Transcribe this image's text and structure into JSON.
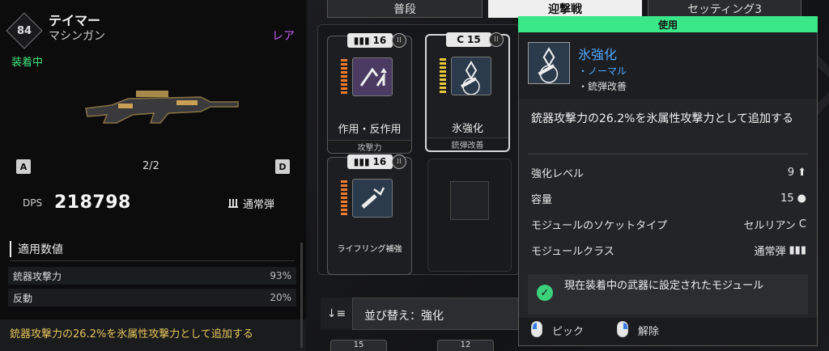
{
  "weapon": {
    "level": "84",
    "name": "テイマー",
    "type": "マシンガン",
    "rarity": "レア",
    "status": "装着中",
    "key_left": "A",
    "key_right": "D",
    "page": "2/2",
    "dps_label": "DPS",
    "dps_value": "218798",
    "ammo_type": "通常弾"
  },
  "applied": {
    "title": "適用数値",
    "stats": [
      {
        "name": "銃器攻撃力",
        "value": "93%"
      },
      {
        "name": "反動",
        "value": "20%"
      }
    ],
    "description": "銃器攻撃力の26.2%を氷属性攻撃力として追加する"
  },
  "tabs": [
    "普段",
    "迎撃戦",
    "セッティング3"
  ],
  "modules": [
    {
      "cost": "16",
      "name": "作用・反作用",
      "tag": "攻撃力",
      "bar_color": "#f07c2a"
    },
    {
      "cost": "15",
      "name": "氷強化",
      "tag": "銃弾改善",
      "bar_color": "#e8c93a"
    },
    {
      "cost": "16",
      "name": "ライフリング補強",
      "tag": "",
      "bar_color": "#f07c2a"
    }
  ],
  "sort": {
    "label": "並び替え：強化"
  },
  "bottom_cards": [
    "15",
    "12"
  ],
  "tooltip": {
    "header": "使用",
    "name": "氷強化",
    "rarity": "・ノーマル",
    "category": "・銃弾改善",
    "description": "銃器攻撃力の26.2%を氷属性攻撃力として追加する",
    "rows": [
      {
        "label": "強化レベル",
        "value": "9",
        "icon": "upgrade-icon"
      },
      {
        "label": "容量",
        "value": "15",
        "icon": "drop-icon"
      },
      {
        "label": "モジュールのソケットタイプ",
        "value": "セルリアン",
        "icon": "socket-c-icon"
      },
      {
        "label": "モジュールクラス",
        "value": "通常弾",
        "icon": "ammo-icon"
      }
    ],
    "note": "現在装着中の武器に設定されたモジュール",
    "pick": "ピック",
    "release": "解除"
  },
  "colors": {
    "accent_green": "#3be889",
    "rare_purple": "#c35df0",
    "name_blue": "#4fa9ff",
    "desc_gold": "#e7c65c"
  }
}
